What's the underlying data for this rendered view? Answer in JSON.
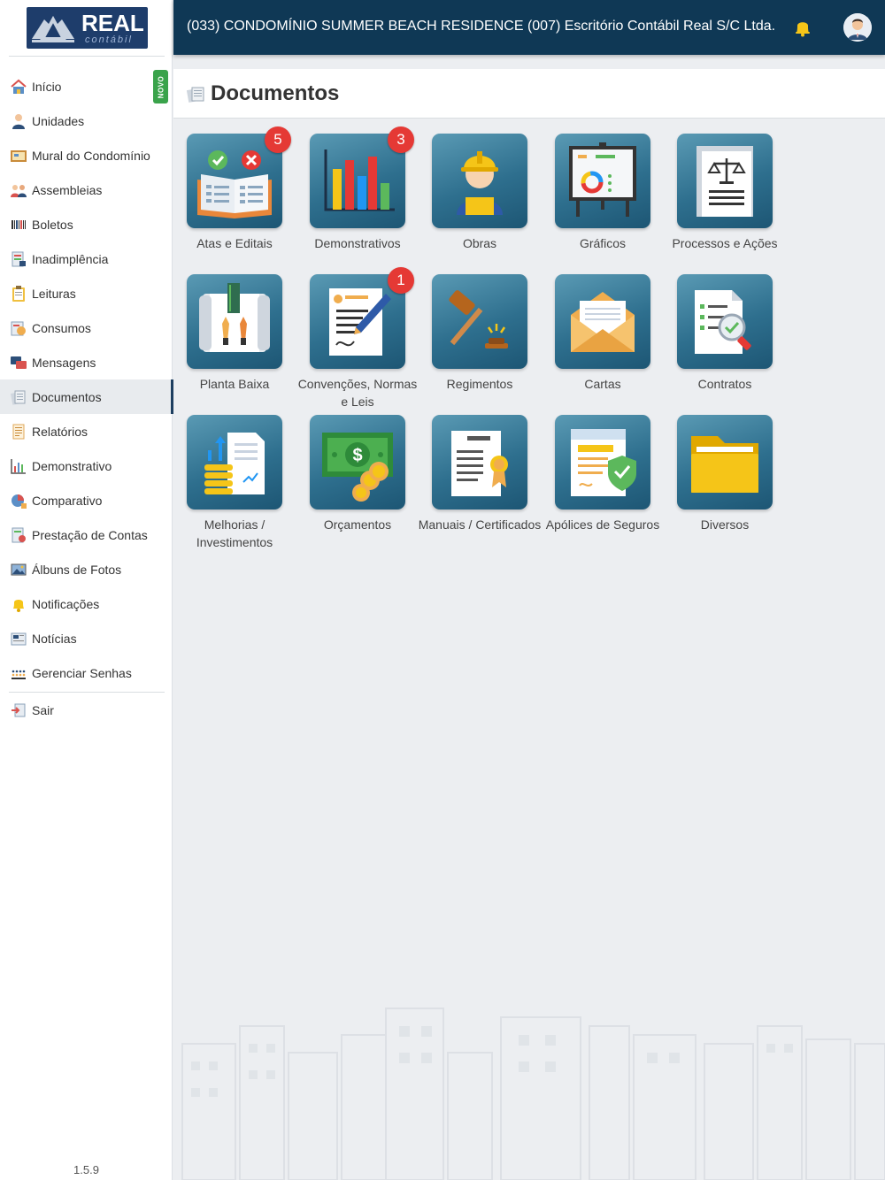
{
  "brand": {
    "logo_text": "REAL",
    "logo_sub": "contábil"
  },
  "topbar": {
    "title": "(033) CONDOMÍNIO SUMMER BEACH RESIDENCE  (007) Escritório Contábil Real S/C Ltda.",
    "bell_icon": "bell-icon",
    "avatar_icon": "user-avatar-icon"
  },
  "sidebar": {
    "items": [
      {
        "label": "Início",
        "icon": "home-icon"
      },
      {
        "label": "Unidades",
        "icon": "person-icon"
      },
      {
        "label": "Mural do Condomínio",
        "icon": "board-icon"
      },
      {
        "label": "Assembleias",
        "icon": "people-icon"
      },
      {
        "label": "Boletos",
        "icon": "barcode-icon"
      },
      {
        "label": "Inadimplência",
        "icon": "ledger-icon"
      },
      {
        "label": "Leituras",
        "icon": "clipboard-icon"
      },
      {
        "label": "Consumos",
        "icon": "meter-icon"
      },
      {
        "label": "Mensagens",
        "icon": "chat-icon"
      },
      {
        "label": "Documentos",
        "icon": "documents-icon"
      },
      {
        "label": "Relatórios",
        "icon": "report-icon"
      },
      {
        "label": "Demonstrativo",
        "icon": "bar-chart-icon"
      },
      {
        "label": "Comparativo",
        "icon": "pie-chart-icon"
      },
      {
        "label": "Prestação de Contas",
        "icon": "accounts-icon"
      },
      {
        "label": "Álbuns de Fotos",
        "icon": "photo-icon"
      },
      {
        "label": "Notificações",
        "icon": "bell-icon"
      },
      {
        "label": "Notícias",
        "icon": "news-icon"
      },
      {
        "label": "Gerenciar Senhas",
        "icon": "keypad-icon"
      }
    ],
    "novo_badge": "NOVO",
    "logout": {
      "label": "Sair",
      "icon": "logout-icon"
    },
    "version": "1.5.9"
  },
  "page": {
    "title": "Documentos",
    "icon": "documents-icon"
  },
  "tiles": [
    {
      "label": "Atas e Editais",
      "badge": "5",
      "icon": "open-book-icon"
    },
    {
      "label": "Demonstrativos",
      "badge": "3",
      "icon": "bar-chart-icon"
    },
    {
      "label": "Obras",
      "icon": "worker-icon"
    },
    {
      "label": "Gráficos",
      "icon": "presentation-board-icon"
    },
    {
      "label": "Processos e Ações",
      "icon": "scales-document-icon"
    },
    {
      "label": "Planta Baixa",
      "icon": "blueprint-icon"
    },
    {
      "label": "Convenções, Normas e Leis",
      "badge": "1",
      "icon": "signed-document-icon"
    },
    {
      "label": "Regimentos",
      "icon": "gavel-icon"
    },
    {
      "label": "Cartas",
      "icon": "envelope-icon"
    },
    {
      "label": "Contratos",
      "icon": "contract-search-icon"
    },
    {
      "label": "Melhorias / Investimentos",
      "icon": "investment-icon"
    },
    {
      "label": "Orçamentos",
      "icon": "money-icon"
    },
    {
      "label": "Manuais / Certificados",
      "icon": "certificate-icon"
    },
    {
      "label": "Apólices de Seguros",
      "icon": "insurance-policy-icon"
    },
    {
      "label": "Diversos",
      "icon": "folder-icon"
    }
  ],
  "colors": {
    "topbar": "#0f3855",
    "tile_bg": "#2e6f8e",
    "badge": "#e53935",
    "novo": "#3aa34b"
  }
}
